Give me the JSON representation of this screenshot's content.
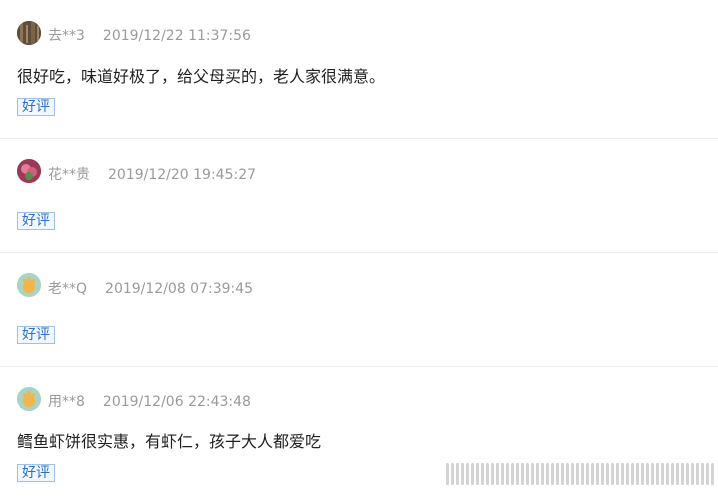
{
  "reviews": [
    {
      "user": "去**3",
      "date": "2019/12/22 11:37:56",
      "content": "很好吃，味道好极了，给父母买的，老人家很满意。",
      "tag": "好评",
      "avatar_icon": "user-avatar-brown-icon",
      "avatar_color": "#6b5a45"
    },
    {
      "user": "花**贵",
      "date": "2019/12/20 19:45:27",
      "content": "",
      "tag": "好评",
      "avatar_icon": "user-avatar-flower-icon",
      "avatar_color": "#b54d6a"
    },
    {
      "user": "老**Q",
      "date": "2019/12/08 07:39:45",
      "content": "",
      "tag": "好评",
      "avatar_icon": "user-avatar-default-icon",
      "avatar_color": "#9cc9b8"
    },
    {
      "user": "用**8",
      "date": "2019/12/06 22:43:48",
      "content": "鳕鱼虾饼很实惠，有虾仁，孩子大人都爱吃",
      "tag": "好评",
      "avatar_icon": "user-avatar-default-icon",
      "avatar_color": "#9cc9b8"
    }
  ],
  "colors": {
    "tag_text": "#2d6fc8",
    "tag_border": "#9ec0ea",
    "meta_text": "#9a9a9a"
  }
}
